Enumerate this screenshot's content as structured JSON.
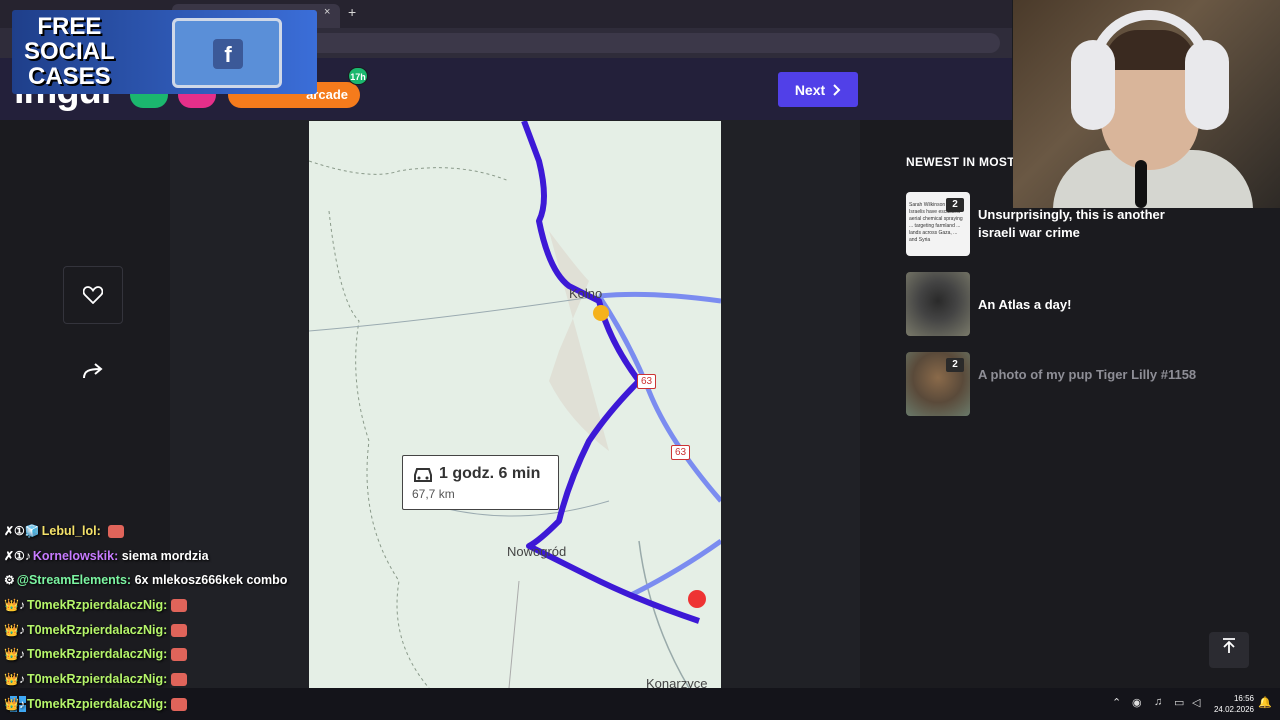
{
  "browser": {
    "tab_close": "×",
    "new_tab": "+"
  },
  "header": {
    "logo": "imgur",
    "arcade_label": "arcade",
    "badge": "17h",
    "next_label": "Next",
    "next_icon": "chevron-right-icon"
  },
  "ad": {
    "line1": "FREE",
    "line2": "SOCIAL",
    "line3": "CASES",
    "crate_brand": "f"
  },
  "post": {
    "favorite_icon": "heart-icon",
    "share_icon": "arrow-right-icon",
    "map": {
      "route_time": "1 godz. 6 min",
      "route_distance": "67,7 km",
      "labels": {
        "kolno": "Kolno",
        "nowogrod": "Nowogród",
        "konarzyce": "Konarzyce",
        "road_63a": "63",
        "road_63b": "63"
      }
    }
  },
  "sidebar": {
    "section_title": "NEWEST IN MOST",
    "items": [
      {
        "title": "Unsurprisingly, this is another israeli war crime",
        "count": "2",
        "faded": false
      },
      {
        "title": "An Atlas a day!",
        "count": "",
        "faded": false
      },
      {
        "title": "A photo of my pup Tiger Lilly #1158",
        "count": "2",
        "faded": true
      }
    ],
    "thumb_text": "Sarah Wilkinson ... Israelis have escalated aerial chemical spraying ... targeting farmland ... lands across Gaza, ... and Syria"
  },
  "scroll_top_icon": "arrow-up-icon",
  "chat": [
    {
      "badges": "✗①🧊",
      "user": "Lebul_lol:",
      "msg": "",
      "user_color": "yellow",
      "emote": true
    },
    {
      "badges": "✗①♪",
      "user": "Kornelowskik:",
      "msg": "siema mordzia",
      "user_color": "purple",
      "emote": false
    },
    {
      "badges": "⚙",
      "user": "@StreamElements:",
      "msg": "6x mlekosz666kek combo",
      "user_color": "green",
      "emote": false
    },
    {
      "badges": "👑♪",
      "user": "T0mekRzpierdalaczNig:",
      "msg": "",
      "user_color": "",
      "emote": true
    },
    {
      "badges": "👑♪",
      "user": "T0mekRzpierdalaczNig:",
      "msg": "",
      "user_color": "",
      "emote": true
    },
    {
      "badges": "👑♪",
      "user": "T0mekRzpierdalaczNig:",
      "msg": "",
      "user_color": "",
      "emote": true
    },
    {
      "badges": "👑♪",
      "user": "T0mekRzpierdalaczNig:",
      "msg": "",
      "user_color": "",
      "emote": true
    },
    {
      "badges": "👑♪",
      "user": "T0mekRzpierdalaczNig:",
      "msg": "",
      "user_color": "",
      "emote": true
    }
  ],
  "taskbar": {
    "time": "16:56",
    "date": "24.02.2026"
  },
  "colors": {
    "accent": "#5140e8",
    "route": "#3d19d6",
    "alt_route": "#7b8cf0"
  }
}
